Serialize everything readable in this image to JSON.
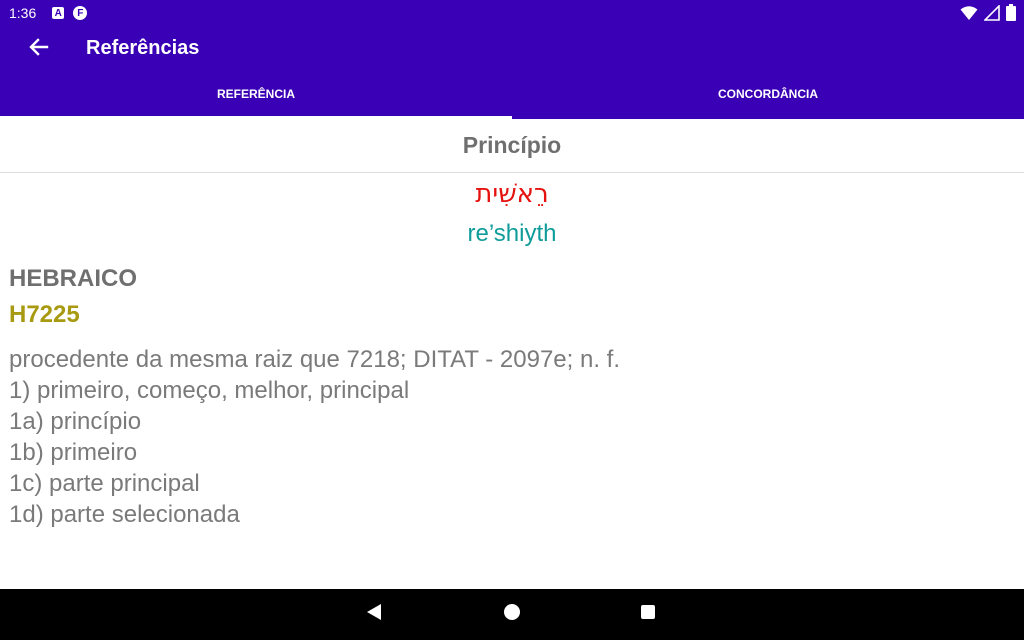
{
  "status_bar": {
    "time": "1:36",
    "icon_a_label": "A",
    "icon_f_label": "F"
  },
  "app_bar": {
    "title": "Referências",
    "back_icon": "arrow-left-icon"
  },
  "tabs": [
    {
      "label": "REFERÊNCIA",
      "selected": true
    },
    {
      "label": "CONCORDÂNCIA",
      "selected": false
    }
  ],
  "entry": {
    "title": "Princípio",
    "hebrew": "רֵאשִׁית",
    "transliteration": "re’shiyth",
    "language": "HEBRAICO",
    "strong_number": "H7225",
    "definition_lines": [
      "procedente da mesma raiz que 7218; DITAT - 2097e; n. f.",
      "1) primeiro, começo, melhor, principal",
      "1a) princípio",
      "1b) primeiro",
      "1c) parte principal",
      "1d) parte selecionada"
    ]
  },
  "colors": {
    "primary": "#3a00b5",
    "hebrew": "#e5120f",
    "transliteration": "#0f9c9a",
    "strong_number": "#a89a10",
    "text_gray": "#6f6f6f"
  }
}
